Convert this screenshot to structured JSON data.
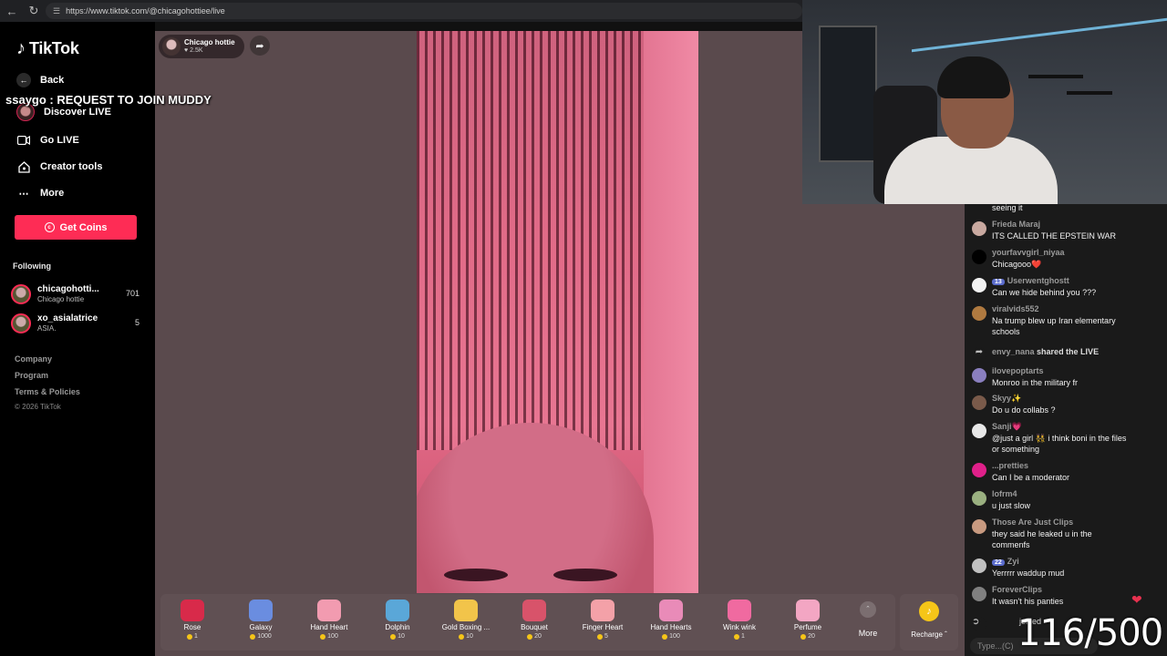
{
  "browser": {
    "url": "https://www.tiktok.com/@chicagohottiee/live"
  },
  "sidebar": {
    "logo": "TikTok",
    "nav": [
      {
        "label": "Back",
        "icon": "arrow-left-icon"
      },
      {
        "label": "Discover LIVE",
        "icon": "live-avatar-icon"
      },
      {
        "label": "Go LIVE",
        "icon": "video-camera-icon"
      },
      {
        "label": "Creator tools",
        "icon": "house-icon"
      },
      {
        "label": "More",
        "icon": "ellipsis-icon"
      }
    ],
    "get_coins": "Get Coins",
    "following_label": "Following",
    "following": [
      {
        "name": "chicagohotti...",
        "sub": "Chicago hottie",
        "count": "701"
      },
      {
        "name": "xo_asialatrice",
        "sub": "ASIA.",
        "count": "5"
      }
    ],
    "footer": [
      "Company",
      "Program",
      "Terms & Policies"
    ],
    "copyright": "© 2026 TikTok"
  },
  "overlay": {
    "request_text": "ssaygo : REQUEST TO JOIN MUDDY"
  },
  "stream": {
    "host_name": "Chicago hottie",
    "likes": "2.5K"
  },
  "gifts": [
    {
      "name": "Rose",
      "price": "1",
      "color": "#d82a4a"
    },
    {
      "name": "Galaxy",
      "price": "1000",
      "color": "#6a8de0"
    },
    {
      "name": "Hand Heart",
      "price": "100",
      "color": "#f29bb0"
    },
    {
      "name": "Dolphin",
      "price": "10",
      "color": "#5aa7d8"
    },
    {
      "name": "Gold Boxing ...",
      "price": "10",
      "color": "#f2c44a"
    },
    {
      "name": "Bouquet",
      "price": "20",
      "color": "#d8536a"
    },
    {
      "name": "Finger Heart",
      "price": "5",
      "color": "#f4a1a8"
    },
    {
      "name": "Hand Hearts",
      "price": "100",
      "color": "#e98bb8"
    },
    {
      "name": "Wink wink",
      "price": "1",
      "color": "#f06aa0"
    },
    {
      "name": "Perfume",
      "price": "20",
      "color": "#f3a6c3"
    }
  ],
  "more_label": "More",
  "recharge_label": "Recharge",
  "chat": {
    "messages": [
      {
        "user": "",
        "text": "seeing it",
        "avatar": "#1a1a1a",
        "badge": ""
      },
      {
        "user": "Frieda Maraj",
        "text": "ITS CALLED THE EPSTEIN WAR",
        "avatar": "#c9a9a0",
        "badge": ""
      },
      {
        "user": "yourfavvgirl_niyaa",
        "text": "Chicagooo❤️",
        "avatar": "#000000",
        "badge": ""
      },
      {
        "user": "Userwentghostt",
        "text": "Can we hide behind you ???",
        "avatar": "#f2f2f2",
        "badge": "13"
      },
      {
        "user": "viralvids552",
        "text": "Na trump blew up Iran elementary schools",
        "avatar": "#b07a40",
        "badge": ""
      },
      {
        "user": "ilovepoptarts",
        "text": "Monroo in the military fr",
        "avatar": "#8a7fbf",
        "badge": ""
      },
      {
        "user": "Skyy✨",
        "text": "Do u do collabs ?",
        "avatar": "#7a5a4a",
        "badge": ""
      },
      {
        "user": "Sanji💗",
        "text": "@just a girl 👯 i think boni in the files or something",
        "avatar": "#e8e8e8",
        "badge": ""
      },
      {
        "user": "...pretties",
        "text": "Can I be a moderator",
        "avatar": "#e0208a",
        "badge": ""
      },
      {
        "user": "lofrm4",
        "text": "u just slow",
        "avatar": "#9ab080",
        "badge": ""
      },
      {
        "user": "Those Are Just Clips",
        "text": "they said he leaked u in the commenfs",
        "avatar": "#c89a80",
        "badge": ""
      },
      {
        "user": "Zyi",
        "text": "Yerrrrr waddup mud",
        "avatar": "#c0c0c0",
        "badge": "22"
      },
      {
        "user": "ForeverClips",
        "text": "It wasn't his panties",
        "avatar": "#808080",
        "badge": ""
      }
    ],
    "shared": {
      "user": "envy_nana",
      "text": "shared the LIVE"
    },
    "joined": "joined",
    "input_placeholder": "Type...(C)"
  },
  "counter": "116/500"
}
